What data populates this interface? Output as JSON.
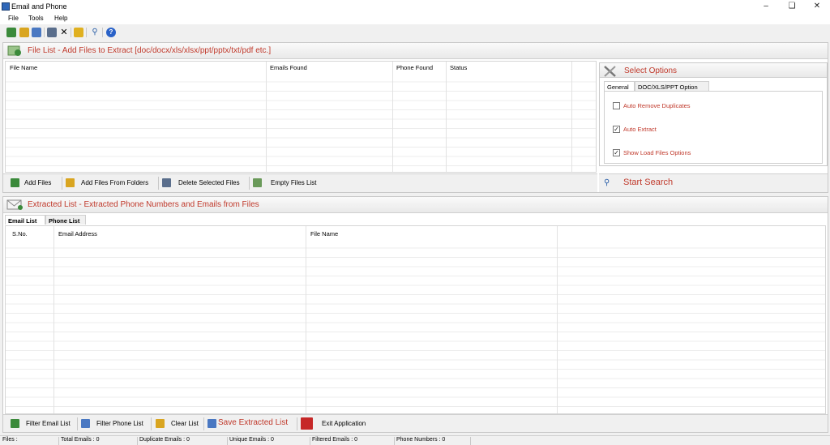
{
  "window": {
    "title": "Email and Phone"
  },
  "menu": [
    "File",
    "Tools",
    "Help"
  ],
  "file_panel": {
    "header": "File List - Add Files to Extract  [doc/docx/xls/xlsx/ppt/pptx/txt/pdf etc.]",
    "columns": [
      "File Name",
      "Emails Found",
      "Phone Found",
      "Status"
    ],
    "actions": {
      "add_files": "Add Files",
      "add_folders": "Add Files From Folders",
      "delete_selected": "Delete Selected Files",
      "empty_list": "Empty Files List"
    }
  },
  "options_panel": {
    "header": "Select Options",
    "tabs": [
      "General",
      "DOC/XLS/PPT Option"
    ],
    "checkboxes": [
      {
        "label": "Auto Remove Duplicates",
        "checked": false
      },
      {
        "label": "Auto Extract",
        "checked": true
      },
      {
        "label": "Show Load Files Options",
        "checked": true
      }
    ],
    "start_search": "Start Search"
  },
  "extracted_panel": {
    "header": "Extracted List - Extracted Phone Numbers and Emails from Files",
    "tabs": [
      "Email List",
      "Phone List"
    ],
    "columns": [
      "S.No.",
      "Email Address",
      "File Name"
    ],
    "actions": {
      "filter_email": "Filter Email List",
      "filter_phone": "Filter Phone List",
      "clear_list": "Clear List",
      "save_list": "Save Extracted List",
      "exit": "Exit Application"
    }
  },
  "status": {
    "files": "Files :",
    "total_emails": "Total Emails :  0",
    "duplicate_emails": "Duplicate Emails :  0",
    "unique_emails": "Unique Emails :  0",
    "filtered_emails": "Filtered Emails :  0",
    "phone_numbers": "Phone Numbers :  0"
  },
  "colors": {
    "accent_red": "#c0392b",
    "border": "#c9c9c9"
  }
}
